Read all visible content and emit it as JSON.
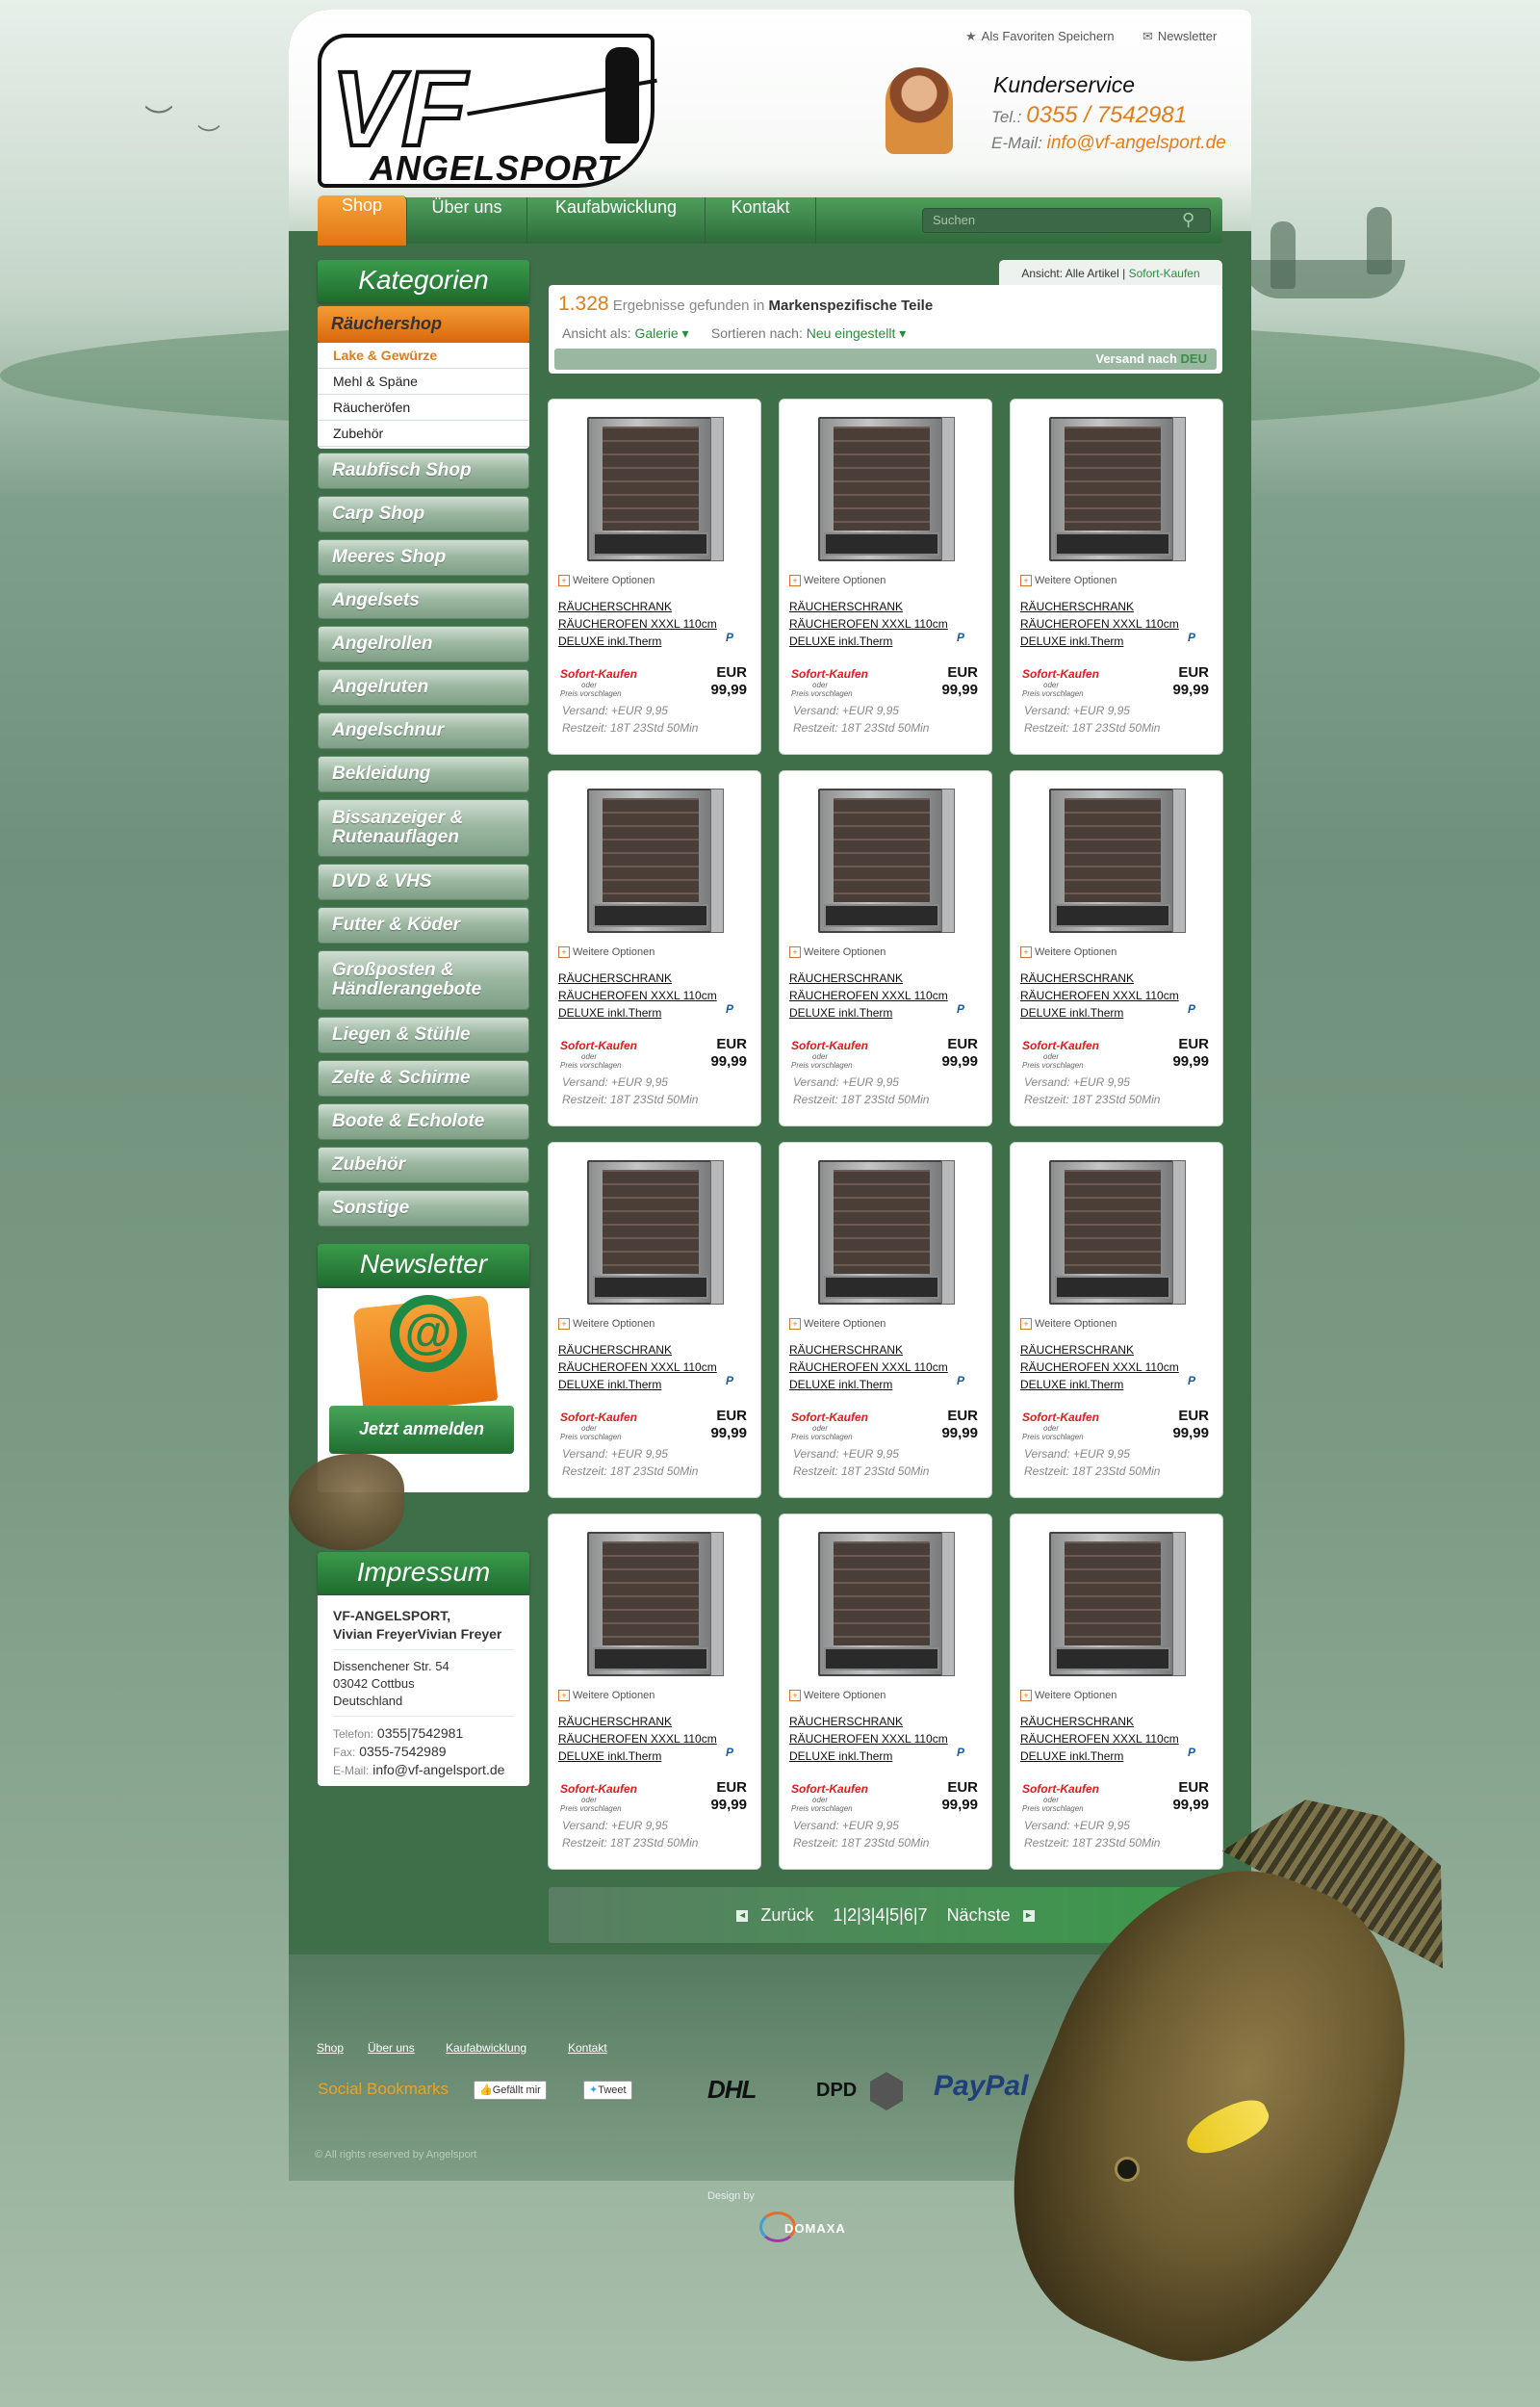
{
  "header": {
    "logo_top": "VF",
    "logo_bottom": "ANGELSPORT",
    "favorites_label": "Als Favoriten Speichern",
    "newsletter_label": "Newsletter",
    "service_title": "Kunderservice",
    "tel_label": "Tel.:",
    "tel_value": "0355 / 7542981",
    "email_label": "E-Mail:",
    "email_value": "info@vf-angelsport.de"
  },
  "nav": {
    "items": [
      "Shop",
      "Über uns",
      "Kaufabwicklung",
      "Kontakt"
    ],
    "active": "Shop",
    "search_placeholder": "Suchen"
  },
  "sidebar": {
    "categories_title": "Kategorien",
    "active_category": "Räuchershop",
    "subcategories": [
      "Lake & Gewürze",
      "Mehl & Späne",
      "Räucheröfen",
      "Zubehör"
    ],
    "current_subcategory": "Lake & Gewürze",
    "categories": [
      "Raubfisch Shop",
      "Carp Shop",
      "Meeres Shop",
      "Angelsets",
      "Angelrollen",
      "Angelruten",
      "Angelschnur",
      "Bekleidung",
      "Bissanzeiger & Rutenauflagen",
      "DVD & VHS",
      "Futter & Köder",
      "Großposten & Händlerangebote",
      "Liegen & Stühle",
      "Zelte & Schirme",
      "Boote & Echolote",
      "Zubehör",
      "Sonstige"
    ],
    "newsletter_title": "Newsletter",
    "newsletter_button": "Jetzt anmelden",
    "impressum_title": "Impressum",
    "impressum": {
      "company": "VF-ANGELSPORT,",
      "owner": "Vivian FreyerVivian Freyer",
      "street": "Dissenchener Str. 54",
      "city": "03042 Cottbus",
      "country": "Deutschland",
      "phone_label": "Telefon:",
      "phone": "0355|7542981",
      "fax_label": "Fax:",
      "fax": "0355-7542989",
      "email_label": "E-Mail:",
      "email": "info@vf-angelsport.de"
    }
  },
  "listing": {
    "view_label": "Ansicht: Alle Artikel",
    "view_separator": "|",
    "view_alt": "Sofort-Kaufen",
    "result_count": "1.328",
    "result_text": "Ergebnisse gefunden in",
    "result_category": "Markenspezifische Teile",
    "view_as_label": "Ansicht als:",
    "view_as_value": "Galerie",
    "sort_label": "Sortieren nach:",
    "sort_value": "Neu eingestellt",
    "shipping_label": "Versand nach",
    "shipping_country": "DEU"
  },
  "products": [
    {
      "options": "Weitere Optionen",
      "title": "RÄUCHERSCHRANK RÄUCHEROFEN XXXL 110cm DELUXE inkl.Therm",
      "buy_label": "Sofort-Kaufen",
      "or_label": "oder",
      "offer_label": "Preis vorschlagen",
      "currency": "EUR",
      "price": "99,99",
      "shipping": "Versand: +EUR 9,95",
      "time_left": "Restzeit: 18T 23Std 50Min"
    },
    {
      "options": "Weitere Optionen",
      "title": "RÄUCHERSCHRANK RÄUCHEROFEN XXXL 110cm DELUXE inkl.Therm",
      "buy_label": "Sofort-Kaufen",
      "or_label": "oder",
      "offer_label": "Preis vorschlagen",
      "currency": "EUR",
      "price": "99,99",
      "shipping": "Versand: +EUR 9,95",
      "time_left": "Restzeit: 18T 23Std 50Min"
    },
    {
      "options": "Weitere Optionen",
      "title": "RÄUCHERSCHRANK RÄUCHEROFEN XXXL 110cm DELUXE inkl.Therm",
      "buy_label": "Sofort-Kaufen",
      "or_label": "oder",
      "offer_label": "Preis vorschlagen",
      "currency": "EUR",
      "price": "99,99",
      "shipping": "Versand: +EUR 9,95",
      "time_left": "Restzeit: 18T 23Std 50Min"
    },
    {
      "options": "Weitere Optionen",
      "title": "RÄUCHERSCHRANK RÄUCHEROFEN XXXL 110cm DELUXE inkl.Therm",
      "buy_label": "Sofort-Kaufen",
      "or_label": "oder",
      "offer_label": "Preis vorschlagen",
      "currency": "EUR",
      "price": "99,99",
      "shipping": "Versand: +EUR 9,95",
      "time_left": "Restzeit: 18T 23Std 50Min"
    },
    {
      "options": "Weitere Optionen",
      "title": "RÄUCHERSCHRANK RÄUCHEROFEN XXXL 110cm DELUXE inkl.Therm",
      "buy_label": "Sofort-Kaufen",
      "or_label": "oder",
      "offer_label": "Preis vorschlagen",
      "currency": "EUR",
      "price": "99,99",
      "shipping": "Versand: +EUR 9,95",
      "time_left": "Restzeit: 18T 23Std 50Min"
    },
    {
      "options": "Weitere Optionen",
      "title": "RÄUCHERSCHRANK RÄUCHEROFEN XXXL 110cm DELUXE inkl.Therm",
      "buy_label": "Sofort-Kaufen",
      "or_label": "oder",
      "offer_label": "Preis vorschlagen",
      "currency": "EUR",
      "price": "99,99",
      "shipping": "Versand: +EUR 9,95",
      "time_left": "Restzeit: 18T 23Std 50Min"
    },
    {
      "options": "Weitere Optionen",
      "title": "RÄUCHERSCHRANK RÄUCHEROFEN XXXL 110cm DELUXE inkl.Therm",
      "buy_label": "Sofort-Kaufen",
      "or_label": "oder",
      "offer_label": "Preis vorschlagen",
      "currency": "EUR",
      "price": "99,99",
      "shipping": "Versand: +EUR 9,95",
      "time_left": "Restzeit: 18T 23Std 50Min"
    },
    {
      "options": "Weitere Optionen",
      "title": "RÄUCHERSCHRANK RÄUCHEROFEN XXXL 110cm DELUXE inkl.Therm",
      "buy_label": "Sofort-Kaufen",
      "or_label": "oder",
      "offer_label": "Preis vorschlagen",
      "currency": "EUR",
      "price": "99,99",
      "shipping": "Versand: +EUR 9,95",
      "time_left": "Restzeit: 18T 23Std 50Min"
    },
    {
      "options": "Weitere Optionen",
      "title": "RÄUCHERSCHRANK RÄUCHEROFEN XXXL 110cm DELUXE inkl.Therm",
      "buy_label": "Sofort-Kaufen",
      "or_label": "oder",
      "offer_label": "Preis vorschlagen",
      "currency": "EUR",
      "price": "99,99",
      "shipping": "Versand: +EUR 9,95",
      "time_left": "Restzeit: 18T 23Std 50Min"
    },
    {
      "options": "Weitere Optionen",
      "title": "RÄUCHERSCHRANK RÄUCHEROFEN XXXL 110cm DELUXE inkl.Therm",
      "buy_label": "Sofort-Kaufen",
      "or_label": "oder",
      "offer_label": "Preis vorschlagen",
      "currency": "EUR",
      "price": "99,99",
      "shipping": "Versand: +EUR 9,95",
      "time_left": "Restzeit: 18T 23Std 50Min"
    },
    {
      "options": "Weitere Optionen",
      "title": "RÄUCHERSCHRANK RÄUCHEROFEN XXXL 110cm DELUXE inkl.Therm",
      "buy_label": "Sofort-Kaufen",
      "or_label": "oder",
      "offer_label": "Preis vorschlagen",
      "currency": "EUR",
      "price": "99,99",
      "shipping": "Versand: +EUR 9,95",
      "time_left": "Restzeit: 18T 23Std 50Min"
    },
    {
      "options": "Weitere Optionen",
      "title": "RÄUCHERSCHRANK RÄUCHEROFEN XXXL 110cm DELUXE inkl.Therm",
      "buy_label": "Sofort-Kaufen",
      "or_label": "oder",
      "offer_label": "Preis vorschlagen",
      "currency": "EUR",
      "price": "99,99",
      "shipping": "Versand: +EUR 9,95",
      "time_left": "Restzeit: 18T 23Std 50Min"
    }
  ],
  "pager": {
    "prev": "Zurück",
    "pages": "1|2|3|4|5|6|7",
    "next": "Nächste"
  },
  "footer": {
    "links": [
      "Shop",
      "Über uns",
      "Kaufabwicklung",
      "Kontakt"
    ],
    "social_label": "Social Bookmarks",
    "like_button": "Gefällt mir",
    "tweet_button": "Tweet",
    "dhl": "DHL",
    "dpd": "DPD",
    "paypal": "PayPal",
    "copyright": "© All rights reserved by Angelsport",
    "design_label": "Design by",
    "design_brand": "DOMAXA"
  },
  "icons": {
    "favorite": "star-icon",
    "newsletter": "envelope-icon",
    "search": "magnifier-icon",
    "options": "plus-box-icon",
    "paypal": "paypal-p-icon"
  },
  "colors": {
    "accent_orange": "#e47c18",
    "brand_green": "#2e8a3e",
    "frame_green": "#3e6f49"
  }
}
